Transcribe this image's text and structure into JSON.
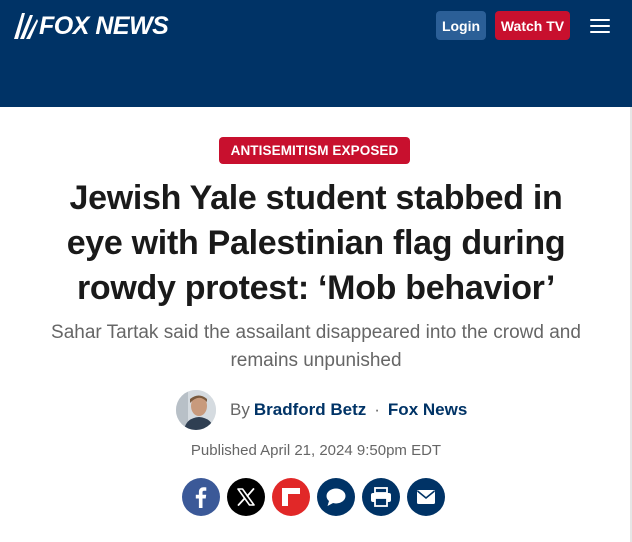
{
  "header": {
    "logo_text": "FOX NEWS",
    "login_label": "Login",
    "watch_label": "Watch TV",
    "menu_icon": "hamburger-menu-icon"
  },
  "article": {
    "kicker": "ANTISEMITISM EXPOSED",
    "headline_lines": [
      "Jewish Yale student stabbed in",
      "eye with Palestinian flag during",
      "rowdy protest: ‘Mob behavior’"
    ],
    "subhead_lines": [
      "Sahar Tartak said the assailant disappeared into the crowd and",
      "remains unpunished"
    ],
    "byline": {
      "by": "By",
      "author": "Bradford Betz",
      "separator": "·",
      "source": "Fox News"
    },
    "published": "Published April 21, 2024 9:50pm EDT"
  },
  "share": [
    {
      "name": "facebook-icon",
      "color": "#3b5998"
    },
    {
      "name": "x-twitter-icon",
      "color": "#000000"
    },
    {
      "name": "flipboard-icon",
      "color": "#e12828"
    },
    {
      "name": "comment-icon",
      "color": "#003366"
    },
    {
      "name": "print-icon",
      "color": "#003366"
    },
    {
      "name": "email-icon",
      "color": "#003366"
    }
  ],
  "colors": {
    "header_bg": "#003366",
    "accent_red": "#c8102e",
    "login_bg": "#2b5f97",
    "link_navy": "#003366"
  }
}
